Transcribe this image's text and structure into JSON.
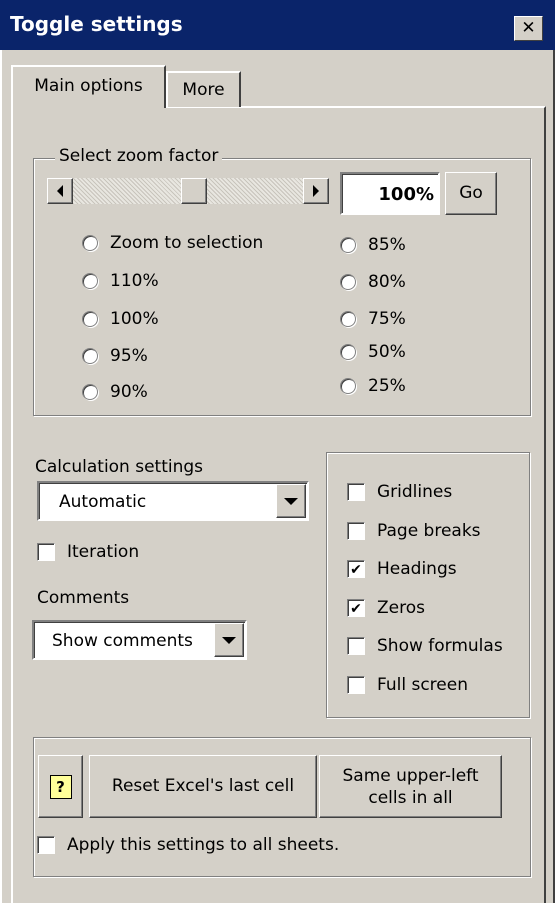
{
  "window": {
    "title": "Toggle settings",
    "close_glyph": "✕"
  },
  "tabs": [
    {
      "label": "Main options",
      "active": true
    },
    {
      "label": "More",
      "active": false
    }
  ],
  "zoom": {
    "group_label": "Select zoom factor",
    "slider_value_percent": 50,
    "input_value": "100%",
    "go_label": "Go",
    "left_options": [
      "Zoom to selection",
      "110%",
      "100%",
      "95%",
      "90%"
    ],
    "right_options": [
      "85%",
      "80%",
      "75%",
      "50%",
      "25%"
    ]
  },
  "calculation": {
    "label": "Calculation settings",
    "selected": "Automatic",
    "iteration_label": "Iteration",
    "iteration_checked": false
  },
  "comments": {
    "label": "Comments",
    "selected": "Show comments"
  },
  "view_options": [
    {
      "label": "Gridlines",
      "checked": false
    },
    {
      "label": "Page breaks",
      "checked": false
    },
    {
      "label": "Headings",
      "checked": true
    },
    {
      "label": "Zeros",
      "checked": true
    },
    {
      "label": "Show formulas",
      "checked": false
    },
    {
      "label": "Full screen",
      "checked": false
    }
  ],
  "bottom": {
    "help_glyph": "?",
    "reset_label": "Reset Excel's last cell",
    "same_upper_left_line1": "Same upper-left",
    "same_upper_left_line2": "cells in all",
    "apply_all_label": "Apply this settings to all sheets.",
    "apply_all_checked": false
  },
  "colors": {
    "titlebar": "#0a246a",
    "face": "#d4d0c8",
    "help_icon_bg": "#ffff99"
  },
  "icons": {
    "close": "close-icon",
    "scroll_left": "arrow-left-icon",
    "scroll_right": "arrow-right-icon",
    "dropdown": "chevron-down-icon",
    "help": "help-icon",
    "check": "check-icon"
  }
}
